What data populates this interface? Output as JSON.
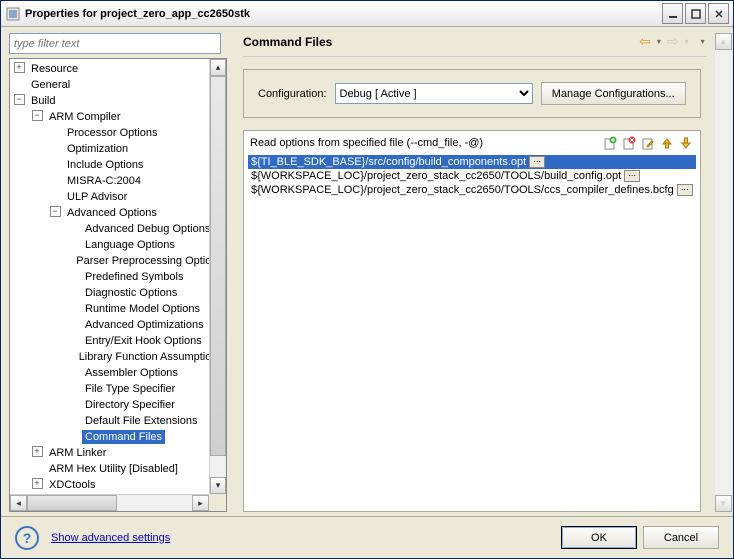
{
  "window": {
    "title": "Properties for project_zero_app_cc2650stk"
  },
  "filter": {
    "placeholder": "type filter text"
  },
  "tree": {
    "resource": "Resource",
    "general": "General",
    "build": "Build",
    "arm_compiler": "ARM Compiler",
    "processor": "Processor Options",
    "optimization": "Optimization",
    "include": "Include Options",
    "misra": "MISRA-C:2004",
    "ulp": "ULP Advisor",
    "advanced": "Advanced Options",
    "adv_debug": "Advanced Debug Options",
    "lang": "Language Options",
    "parser": "Parser Preprocessing Options",
    "predef": "Predefined Symbols",
    "diag": "Diagnostic Options",
    "runtime": "Runtime Model Options",
    "adv_opt": "Advanced Optimizations",
    "entry": "Entry/Exit Hook Options",
    "lib": "Library Function Assumptions",
    "asm": "Assembler Options",
    "ftype": "File Type Specifier",
    "dir": "Directory Specifier",
    "defext": "Default File Extensions",
    "cmdfiles": "Command Files",
    "linker": "ARM Linker",
    "hex": "ARM Hex Utility  [Disabled]",
    "xdc": "XDCtools"
  },
  "page": {
    "title": "Command Files",
    "config_label": "Configuration:",
    "config_value": "Debug  [ Active ]",
    "manage": "Manage Configurations...",
    "list_label": "Read options from specified file (--cmd_file, -@)",
    "rows": [
      "${TI_BLE_SDK_BASE}/src/config/build_components.opt",
      "${WORKSPACE_LOC}/project_zero_stack_cc2650/TOOLS/build_config.opt",
      "${WORKSPACE_LOC}/project_zero_stack_cc2650/TOOLS/ccs_compiler_defines.bcfg"
    ]
  },
  "footer": {
    "advanced": "Show advanced settings",
    "ok": "OK",
    "cancel": "Cancel"
  }
}
